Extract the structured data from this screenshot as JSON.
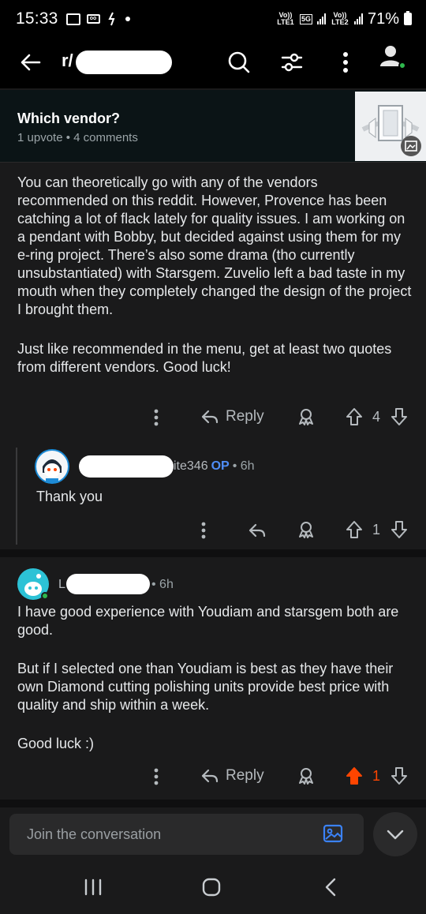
{
  "status_bar": {
    "time": "15:33",
    "network_1": "Vo)) LTE1",
    "network_5g": "5G",
    "network_2": "Vo)) LTE2",
    "battery": "71%"
  },
  "app_bar": {
    "subreddit_prefix": "r/"
  },
  "post": {
    "title": "Which vendor?",
    "meta": "1 upvote • 4 comments"
  },
  "comment1": {
    "paragraph1": "You can theoretically go with any of the vendors recommended on this reddit. However, Provence has been catching a lot of flack lately for quality issues. I am working on a pendant with Bobby, but decided against using them for my e-ring project. There’s also some drama (tho currently unsubstantiated) with Starsgem. Zuvelio left a bad taste in my mouth when they completely changed the design of the project I brought them.",
    "paragraph2": "Just like recommended in the menu, get at least two quotes from different vendors. Good luck!",
    "reply_label": "Reply",
    "score": "4"
  },
  "comment2": {
    "user_visible": "ite346",
    "op": "OP",
    "age": "• 6h",
    "text": "Thank you",
    "score": "1"
  },
  "comment3": {
    "user_visible": "L",
    "age": "• 6h",
    "paragraph1": "I have good experience with Youdiam and starsgem both are good.",
    "paragraph2": "But if I selected one than Youdiam is best as they have their own Diamond cutting polishing units provide best price with quality and ship within a week.",
    "paragraph3": "Good luck :)",
    "reply_label": "Reply",
    "score": "1",
    "upvoted_color": "#ff4500"
  },
  "composer": {
    "placeholder": "Join the conversation"
  },
  "colors": {
    "background": "#1a1a1b",
    "op_badge": "#4f8ef7",
    "online": "#2fb84e"
  }
}
